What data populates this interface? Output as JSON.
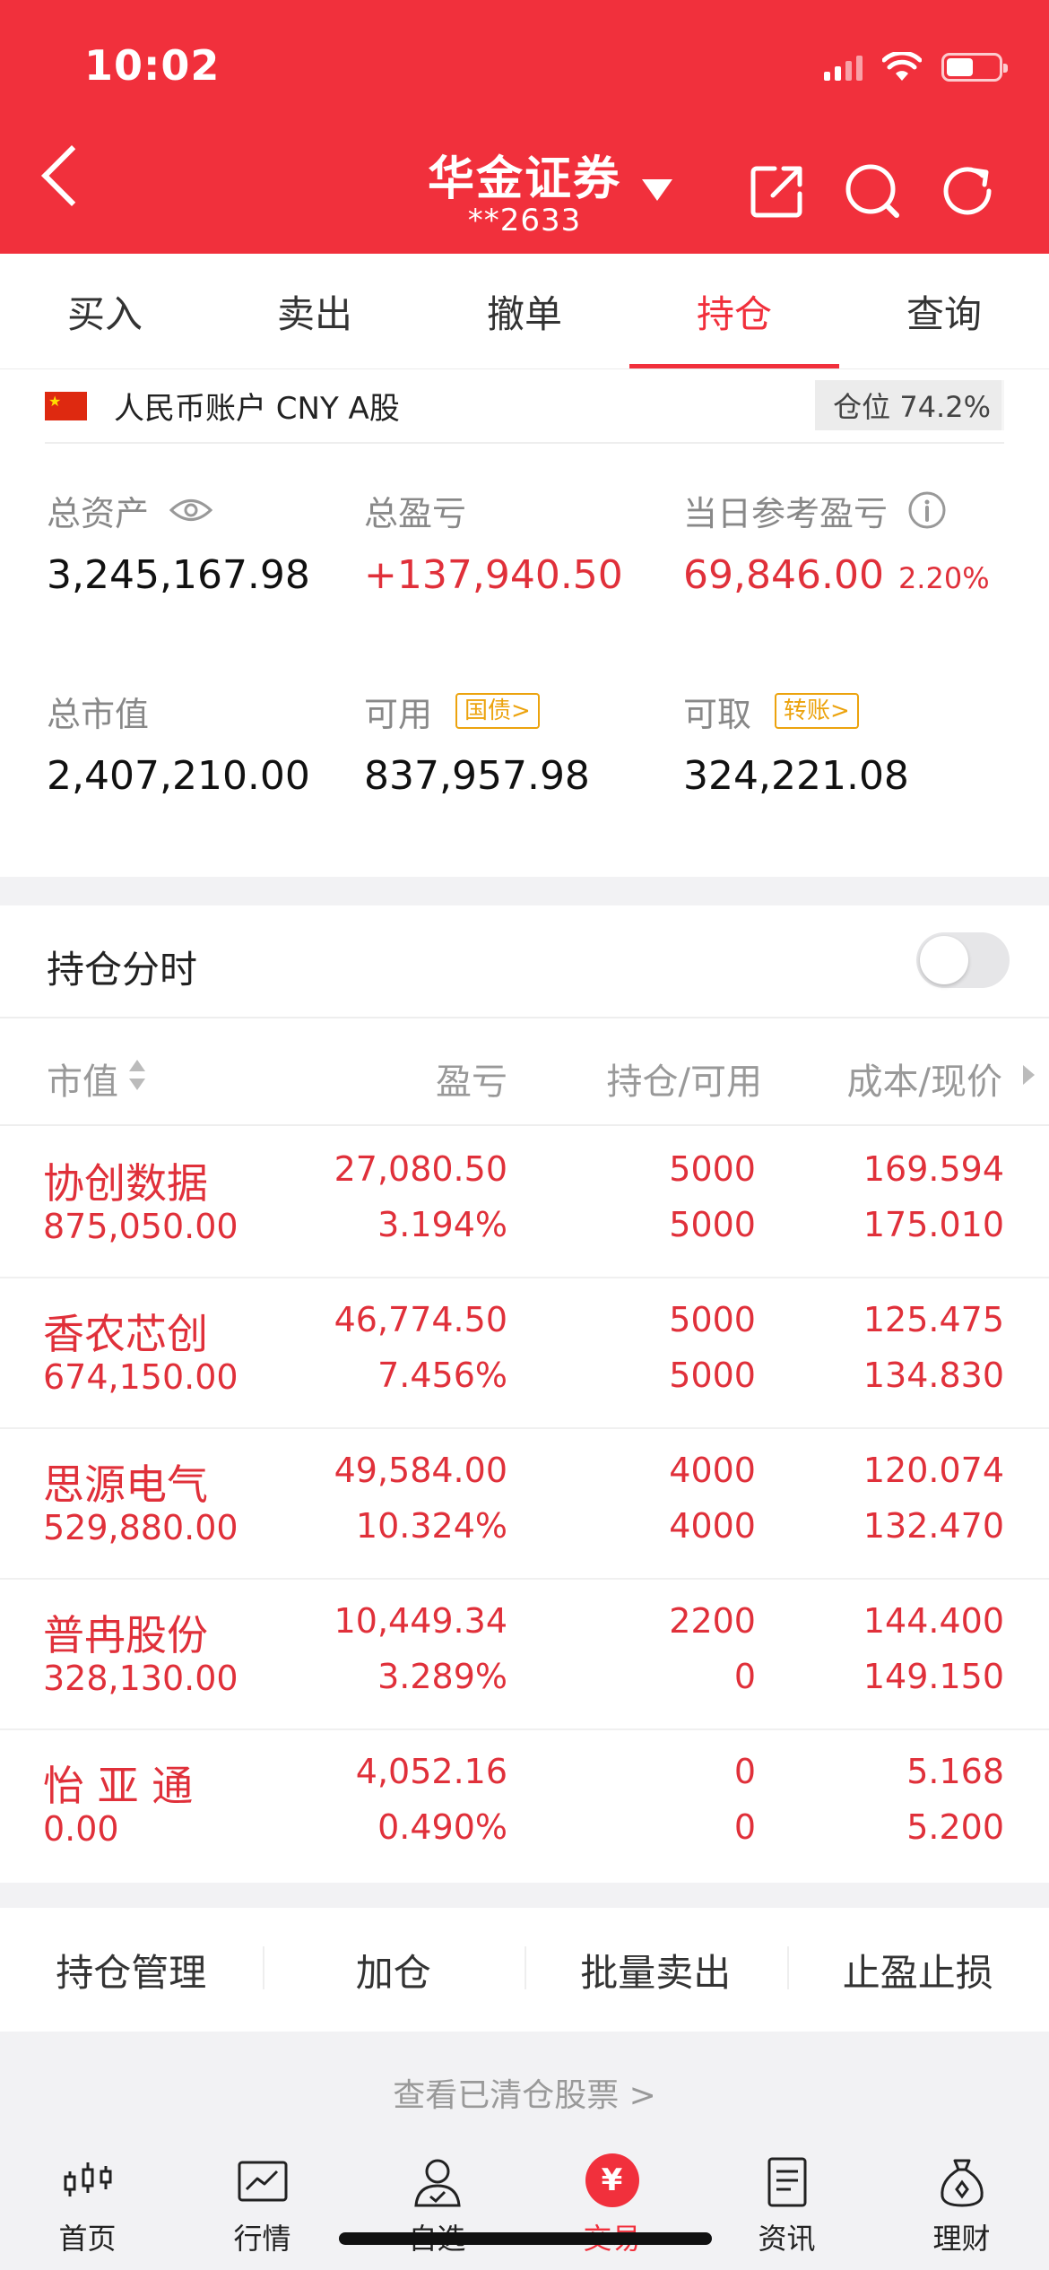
{
  "status_bar": {
    "time": "10:02"
  },
  "header": {
    "title": "华金证券",
    "account": "**2633"
  },
  "tabs": [
    {
      "label": "买入",
      "active": false
    },
    {
      "label": "卖出",
      "active": false
    },
    {
      "label": "撤单",
      "active": false
    },
    {
      "label": "持仓",
      "active": true
    },
    {
      "label": "查询",
      "active": false
    }
  ],
  "account": {
    "label": "人民币账户 CNY A股",
    "position_ratio": "仓位 74.2%",
    "total_assets_label": "总资产",
    "total_assets": "3,245,167.98",
    "total_pl_label": "总盈亏",
    "total_pl": "+137,940.50",
    "daily_pl_label": "当日参考盈亏",
    "daily_pl": "69,846.00",
    "daily_pl_pct": "2.20%",
    "market_value_label": "总市值",
    "market_value": "2,407,210.00",
    "available_label": "可用",
    "available_tag": "国债>",
    "available": "837,957.98",
    "withdrawable_label": "可取",
    "withdrawable_tag": "转账>",
    "withdrawable": "324,221.08"
  },
  "holdings": {
    "timeshare_label": "持仓分时",
    "timeshare_enabled": false,
    "columns": {
      "market_value": "市值",
      "pl": "盈亏",
      "qty": "持仓/可用",
      "price": "成本/现价"
    },
    "rows": [
      {
        "name": "协创数据",
        "market_value": "875,050.00",
        "pl": "27,080.50",
        "pl_pct": "3.194%",
        "position": "5000",
        "available": "5000",
        "cost": "169.594",
        "price": "175.010"
      },
      {
        "name": "香农芯创",
        "market_value": "674,150.00",
        "pl": "46,774.50",
        "pl_pct": "7.456%",
        "position": "5000",
        "available": "5000",
        "cost": "125.475",
        "price": "134.830"
      },
      {
        "name": "思源电气",
        "market_value": "529,880.00",
        "pl": "49,584.00",
        "pl_pct": "10.324%",
        "position": "4000",
        "available": "4000",
        "cost": "120.074",
        "price": "132.470"
      },
      {
        "name": "普冉股份",
        "market_value": "328,130.00",
        "pl": "10,449.34",
        "pl_pct": "3.289%",
        "position": "2200",
        "available": "0",
        "cost": "144.400",
        "price": "149.150"
      },
      {
        "name": "怡 亚 通",
        "market_value": "0.00",
        "pl": "4,052.16",
        "pl_pct": "0.490%",
        "position": "0",
        "available": "0",
        "cost": "5.168",
        "price": "5.200"
      }
    ]
  },
  "actions": [
    "持仓管理",
    "加仓",
    "批量卖出",
    "止盈止损"
  ],
  "cleared_link": "查看已清仓股票 >",
  "bottom_nav": [
    {
      "label": "首页",
      "icon": "candlestick-icon"
    },
    {
      "label": "行情",
      "icon": "chart-icon"
    },
    {
      "label": "自选",
      "icon": "person-check-icon"
    },
    {
      "label": "交易",
      "icon": "yuan-icon",
      "symbol": "¥"
    },
    {
      "label": "资讯",
      "icon": "document-icon"
    },
    {
      "label": "理财",
      "icon": "money-bag-icon"
    }
  ],
  "colors": {
    "brand": "#f1303c",
    "gain": "#e0303a",
    "tag": "#eca30e"
  }
}
